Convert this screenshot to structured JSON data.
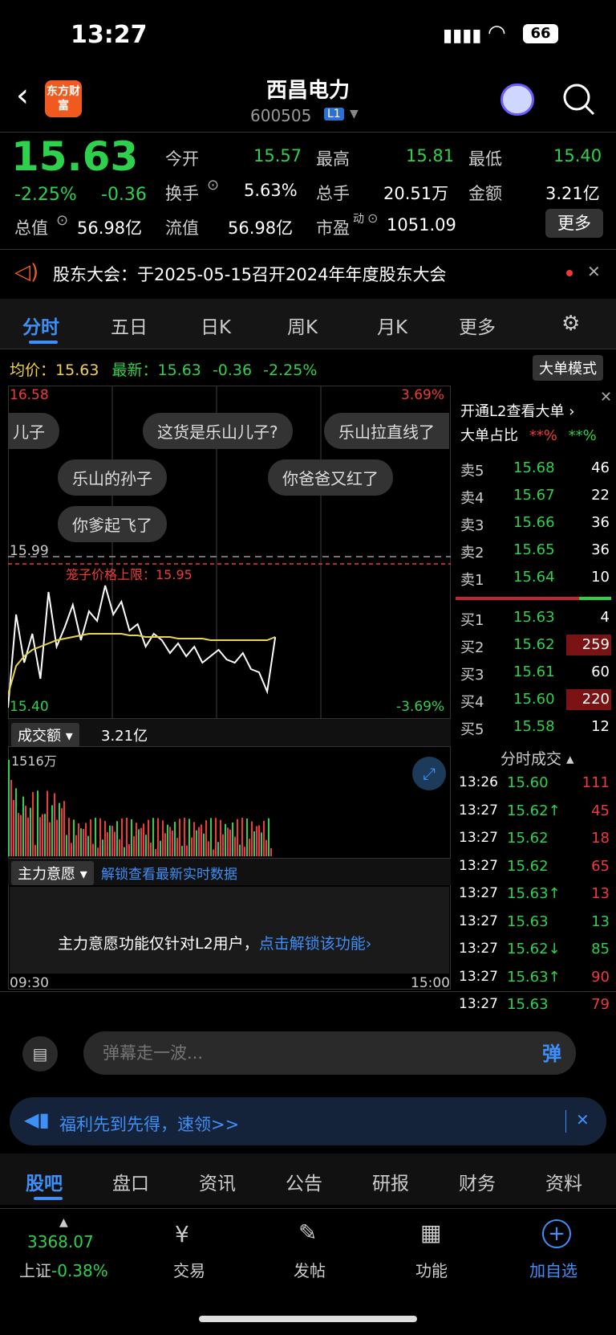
{
  "status": {
    "time": "13:27",
    "battery": "66"
  },
  "header": {
    "title": "西昌电力",
    "code": "600505",
    "level": "L1",
    "logo_text": "东方财富"
  },
  "quote": {
    "price": "15.63",
    "pct": "-2.25%",
    "chg": "-0.36",
    "today_open_label": "今开",
    "today_open": "15.57",
    "high_label": "最高",
    "high": "15.81",
    "low_label": "最低",
    "low": "15.40",
    "turnover_label": "换手",
    "turnover": "5.63%",
    "volume_label": "总手",
    "volume": "20.51万",
    "amount_label": "金额",
    "amount": "3.21亿",
    "mcap_label": "总值",
    "mcap": "56.98亿",
    "float_label": "流值",
    "float": "56.98亿",
    "pe_label": "市盈",
    "pe_sup": "动",
    "pe": "1051.09",
    "more": "更多"
  },
  "notice": {
    "text": "股东大会：于2025-05-15召开2024年年度股东大会"
  },
  "tabs": [
    "分时",
    "五日",
    "日K",
    "周K",
    "月K",
    "更多"
  ],
  "chart": {
    "avg_label": "均价：",
    "avg": "15.63",
    "latest_label": "最新：",
    "latest": "15.63",
    "chg": "-0.36",
    "pct": "-2.25%",
    "mode_btn": "大单模式",
    "top_price": "16.58",
    "top_pct": "3.69%",
    "bottom_price": "15.40",
    "bottom_pct": "-3.69%",
    "ref_price": "15.99",
    "cage_label": "笼子价格上限：15.95",
    "danmaku": [
      "儿子",
      "这货是乐山儿子?",
      "乐山拉直线了",
      "乐山的孙子",
      "你爸爸又红了",
      "你爹起飞了"
    ],
    "vol_label": "成交额",
    "vol_total": "3.21亿",
    "vol_max": "1516万",
    "force_label": "主力意愿",
    "force_link": "解锁查看最新实时数据",
    "force_msg": "主力意愿功能仅针对L2用户，",
    "force_unlock": "点击解锁该功能",
    "t_start": "09:30",
    "t_end": "15:00"
  },
  "chart_data": {
    "type": "line",
    "series": [
      {
        "values": [
          15.41,
          15.7,
          15.55,
          15.64,
          15.5,
          15.77,
          15.6,
          15.66,
          15.73,
          15.62,
          15.71,
          15.68,
          15.79,
          15.7,
          15.74,
          15.65,
          15.67,
          15.6,
          15.64,
          15.62,
          15.58,
          15.61,
          15.57,
          15.6,
          15.55,
          15.57,
          15.59,
          15.56,
          15.55,
          15.58,
          15.53,
          15.52,
          15.46,
          15.63
        ]
      },
      {
        "values": [
          15.45,
          15.54,
          15.57,
          15.59,
          15.6,
          15.61,
          15.62,
          15.625,
          15.63,
          15.635,
          15.64,
          15.64,
          15.64,
          15.64,
          15.64,
          15.635,
          15.635,
          15.63,
          15.63,
          15.63,
          15.63,
          15.625,
          15.625,
          15.625,
          15.625,
          15.62,
          15.62,
          15.62,
          15.62,
          15.62,
          15.62,
          15.62,
          15.62,
          15.63
        ]
      }
    ],
    "ylim": [
      15.4,
      16.58
    ]
  },
  "orderbook": {
    "l2": "开通L2查看大单",
    "ratio_label": "大单占比",
    "ratio_sell": "**%",
    "ratio_buy": "**%",
    "asks": [
      {
        "label": "卖5",
        "price": "15.68",
        "vol": "46"
      },
      {
        "label": "卖4",
        "price": "15.67",
        "vol": "22"
      },
      {
        "label": "卖3",
        "price": "15.66",
        "vol": "36"
      },
      {
        "label": "卖2",
        "price": "15.65",
        "vol": "36"
      },
      {
        "label": "卖1",
        "price": "15.64",
        "vol": "10"
      }
    ],
    "bids": [
      {
        "label": "买1",
        "price": "15.63",
        "vol": "4"
      },
      {
        "label": "买2",
        "price": "15.62",
        "vol": "259"
      },
      {
        "label": "买3",
        "price": "15.61",
        "vol": "60"
      },
      {
        "label": "买4",
        "price": "15.60",
        "vol": "220"
      },
      {
        "label": "买5",
        "price": "15.58",
        "vol": "12"
      }
    ],
    "trades_label": "分时成交",
    "trades": [
      {
        "t": "13:26",
        "p": "15.60",
        "v": "111"
      },
      {
        "t": "13:27",
        "p": "15.62↑",
        "v": "45"
      },
      {
        "t": "13:27",
        "p": "15.62",
        "v": "18"
      },
      {
        "t": "13:27",
        "p": "15.62",
        "v": "65"
      },
      {
        "t": "13:27",
        "p": "15.63↑",
        "v": "13"
      },
      {
        "t": "13:27",
        "p": "15.63",
        "v": "13"
      },
      {
        "t": "13:27",
        "p": "15.62↓",
        "v": "85"
      },
      {
        "t": "13:27",
        "p": "15.63↑",
        "v": "90"
      },
      {
        "t": "13:27",
        "p": "15.63",
        "v": "79"
      }
    ]
  },
  "comment": {
    "placeholder": "弹幕走一波...",
    "btn": "弹"
  },
  "promo": {
    "text": "福利先到先得，速领>>"
  },
  "subtabs": [
    "股吧",
    "盘口",
    "资讯",
    "公告",
    "研报",
    "财务",
    "资料"
  ],
  "bottombar": {
    "index_val": "3368.07",
    "index_name": "上证",
    "index_pct": "-0.38%",
    "trade": "交易",
    "post": "发帖",
    "func": "功能",
    "add": "加自选"
  }
}
